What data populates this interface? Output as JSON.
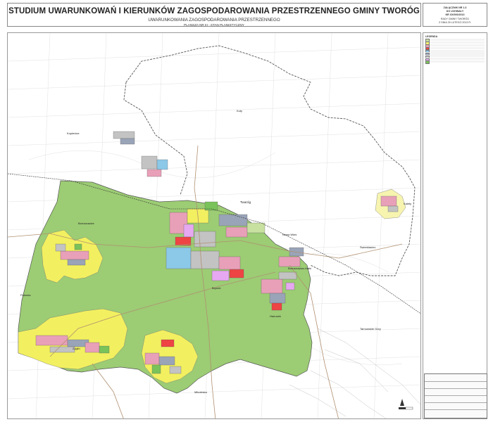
{
  "title": {
    "main": "STUDIUM UWARUNKOWAŃ I KIERUNKÓW ZAGOSPODAROWANIA PRZESTRZENNEGO GMINY TWORÓG",
    "sub": "UWARUNKOWANIA ZAGOSPODAROWANIA PRZESTRZENNEGO",
    "sheet": "PLANSZA NR III - STAN PLANISTYCZNY"
  },
  "annex": {
    "line1": "ZAŁĄCZNIK NR 1.3",
    "line2": "DO UCHWAŁY",
    "line3": "NR XX/000/2013",
    "line4": "RADY GMINY TWORÓG",
    "line5": "Z DNIA 25 LUTEGO 2013 R."
  },
  "legend": {
    "heading": "LEGENDA",
    "rows": [
      {
        "color": "#c8e0a0"
      },
      {
        "color": "#f6f36a"
      },
      {
        "color": "#e9a3b8"
      },
      {
        "color": "#ee4444"
      },
      {
        "color": "#8cc8e8"
      },
      {
        "color": "#9aa4b8"
      },
      {
        "color": "#c3c3c3"
      },
      {
        "color": "#e6a8f0"
      },
      {
        "color": "#7ac25a"
      }
    ]
  },
  "places": [
    {
      "name": "Twaróg"
    },
    {
      "name": "Boruszowice"
    },
    {
      "name": "Kopienice"
    },
    {
      "name": "Nowa Wieś"
    },
    {
      "name": "Brynek"
    },
    {
      "name": "Hanusek"
    },
    {
      "name": "Świerklaniec"
    },
    {
      "name": "Tarnowskie Góry"
    },
    {
      "name": "Żyglin"
    },
    {
      "name": "Kalety"
    },
    {
      "name": "Połomia"
    },
    {
      "name": "Kuty"
    },
    {
      "name": "Mikołeska"
    },
    {
      "name": "Boruszowice-Hutki"
    }
  ],
  "colors": {
    "forest": "#9ccc74",
    "agricultural": "#f2f060",
    "residential": "#e8a0b8",
    "industrial": "#c3c3c3",
    "water": "#8cc8e8",
    "boundary": "#555555"
  }
}
